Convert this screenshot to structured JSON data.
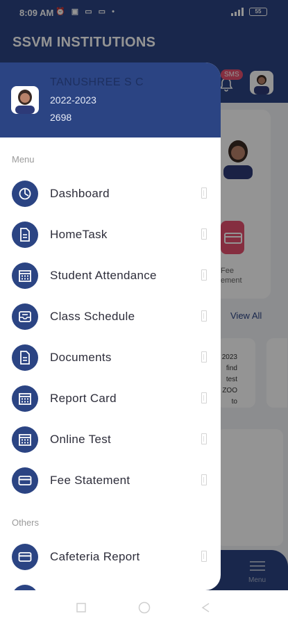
{
  "status_bar": {
    "time": "8:09 AM",
    "icons_left": "⏰ ▣ ▭ ▭ •",
    "battery": "55"
  },
  "app_bar": {
    "title": "SSVM INSTITUTIONS",
    "sms_badge": "SMS"
  },
  "background": {
    "fee_label_line1": "Fee",
    "fee_label_line2": "ement",
    "view_all": "View All",
    "card_lines": [
      "2023",
      "find",
      "test",
      "ZOO",
      "to"
    ],
    "bottom_nav_label": "Menu"
  },
  "drawer": {
    "profile": {
      "name": "TANUSHREE S C",
      "year": "2022-2023",
      "id": "2698"
    },
    "menu_section": "Menu",
    "others_section": "Others",
    "items": [
      {
        "label": "Dashboard",
        "icon": "dashboard-icon"
      },
      {
        "label": "HomeTask",
        "icon": "document-icon"
      },
      {
        "label": "Student Attendance",
        "icon": "calendar-icon"
      },
      {
        "label": "Class Schedule",
        "icon": "inbox-icon"
      },
      {
        "label": "Documents",
        "icon": "document-icon"
      },
      {
        "label": "Report Card",
        "icon": "calendar-icon"
      },
      {
        "label": "Online Test",
        "icon": "calendar-icon"
      },
      {
        "label": "Fee Statement",
        "icon": "card-icon"
      }
    ],
    "other_items": [
      {
        "label": "Cafeteria Report",
        "icon": "card-icon"
      }
    ]
  },
  "colors": {
    "primary": "#2b4483",
    "badge": "#e5506e"
  }
}
